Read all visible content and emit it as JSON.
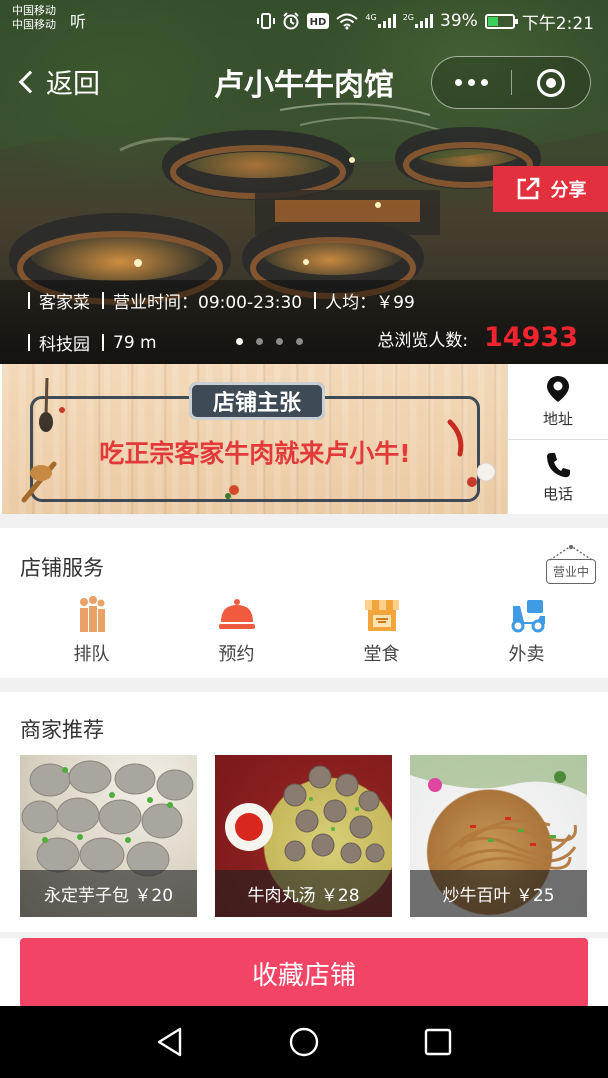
{
  "status_bar": {
    "carrier_1": "中国移动",
    "carrier_2": "中国移动",
    "carrier_speaker": "听",
    "network_1": "4G",
    "network_2": "2G",
    "battery_percent": "39%",
    "battery_level": 0.39,
    "time": "下午2:21"
  },
  "nav": {
    "back_label": "返回",
    "title": "卢小牛牛肉馆"
  },
  "hero": {
    "share_label": "分享",
    "cuisine": "客家菜",
    "hours": "营业时间：09:00-23:30",
    "avg_price": "人均：￥99",
    "area": "科技园",
    "distance": "79 m",
    "views_label": "总浏览人数:",
    "views_count": "14933",
    "pager_total": 4,
    "pager_active": 0
  },
  "banner": {
    "tab": "店铺主张",
    "slogan": "吃正宗客家牛肉就来卢小牛!"
  },
  "side_actions": {
    "address_label": "地址",
    "phone_label": "电话"
  },
  "services": {
    "title": "店铺服务",
    "open_sign": "营业中",
    "items": [
      {
        "label": "排队",
        "icon": "queue-icon"
      },
      {
        "label": "预约",
        "icon": "reservation-bell-icon"
      },
      {
        "label": "堂食",
        "icon": "dine-in-store-icon"
      },
      {
        "label": "外卖",
        "icon": "delivery-scooter-icon"
      }
    ]
  },
  "recommend": {
    "title": "商家推荐",
    "dishes": [
      {
        "label": "永定芋子包 ￥20"
      },
      {
        "label": "牛肉丸汤 ￥28"
      },
      {
        "label": "炒牛百叶 ￥25"
      }
    ]
  },
  "collect_label": "收藏店铺",
  "colors": {
    "accent": "#f24464",
    "share": "#e3303f",
    "views_count": "#f0242f",
    "slogan": "#e23a3a"
  }
}
